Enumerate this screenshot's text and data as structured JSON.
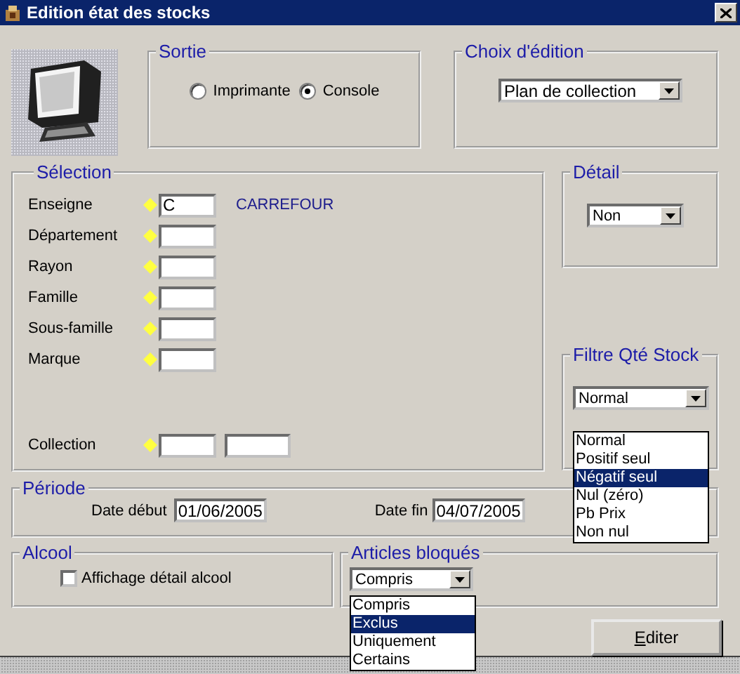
{
  "window": {
    "title": "Edition état des stocks"
  },
  "sortie": {
    "title": "Sortie",
    "options": [
      {
        "label": "Imprimante",
        "selected": false
      },
      {
        "label": "Console",
        "selected": true
      }
    ]
  },
  "choix_edition": {
    "title": "Choix d'édition",
    "value": "Plan de collection"
  },
  "selection": {
    "title": "Sélection",
    "fields": [
      {
        "label": "Enseigne",
        "kind": "single",
        "value": "C",
        "description": "CARREFOUR"
      },
      {
        "label": "Département",
        "kind": "single"
      },
      {
        "label": "Rayon",
        "kind": "single"
      },
      {
        "label": "Famille",
        "kind": "single"
      },
      {
        "label": "Sous-famille",
        "kind": "single"
      },
      {
        "label": "Marque",
        "kind": "single"
      },
      {
        "label": "Collection",
        "kind": "range"
      }
    ]
  },
  "detail": {
    "title": "Détail",
    "value": "Non"
  },
  "filtre_qte_stock": {
    "title": "Filtre Qté Stock",
    "value": "Normal",
    "expanded": true,
    "options": [
      {
        "label": "Normal",
        "highlighted": false
      },
      {
        "label": "Positif seul",
        "highlighted": false
      },
      {
        "label": "Négatif seul",
        "highlighted": true
      },
      {
        "label": "Nul (zéro)",
        "highlighted": false
      },
      {
        "label": "Pb Prix",
        "highlighted": false
      },
      {
        "label": "Non nul",
        "highlighted": false
      }
    ]
  },
  "periode": {
    "title": "Période",
    "date_debut": {
      "label": "Date début",
      "value": "01/06/2005"
    },
    "date_fin": {
      "label": "Date fin",
      "value": "04/07/2005"
    }
  },
  "alcool": {
    "title": "Alcool",
    "checkbox": {
      "label": "Affichage détail alcool",
      "checked": false
    }
  },
  "articles_bloques": {
    "title": "Articles bloqués",
    "value": "Compris",
    "expanded": true,
    "options": [
      {
        "label": "Compris",
        "highlighted": false
      },
      {
        "label": "Exclus",
        "highlighted": true
      },
      {
        "label": "Uniquement",
        "highlighted": false
      },
      {
        "label": "Certains",
        "highlighted": false
      }
    ]
  },
  "buttons": [
    {
      "underlined": "E",
      "rest": "diter"
    }
  ]
}
